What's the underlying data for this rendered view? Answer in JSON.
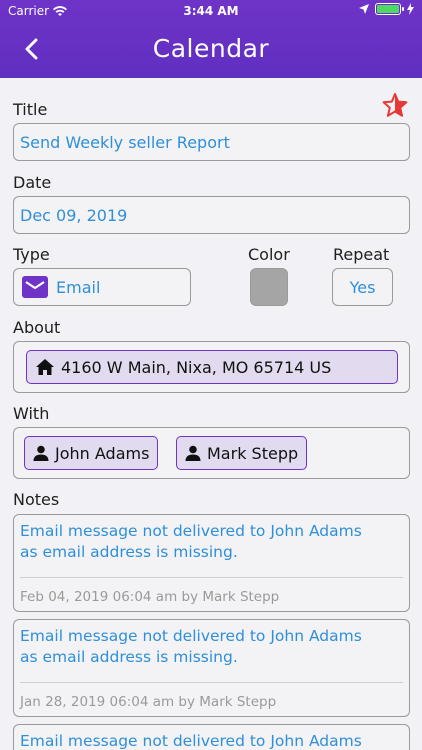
{
  "status_bar": {
    "carrier": "Carrier",
    "time": "3:44 AM",
    "battery_color": "#4cd964"
  },
  "header": {
    "title": "Calendar",
    "back_icon": "chevron-left-icon",
    "background": "#6f33c8"
  },
  "form": {
    "title_label": "Title",
    "title_value": "Send Weekly seller Report",
    "favorite_icon": "star-icon",
    "favorite_color": "#e53935",
    "date_label": "Date",
    "date_value": "Dec 09, 2019",
    "type_label": "Type",
    "type_value": "Email",
    "type_icon": "mail-icon",
    "color_label": "Color",
    "color_value": "#a5a5a5",
    "repeat_label": "Repeat",
    "repeat_value": "Yes",
    "about_label": "About",
    "about_value": "4160 W Main, Nixa, MO 65714 US",
    "about_icon": "home-icon",
    "with_label": "With",
    "with_people": [
      "John Adams",
      "Mark Stepp"
    ],
    "person_icon": "person-icon",
    "notes_label": "Notes"
  },
  "notes": [
    {
      "message_line1": "Email message not delivered to John Adams",
      "message_line2": "as email address is missing.",
      "meta": "Feb 04, 2019 06:04 am by Mark Stepp"
    },
    {
      "message_line1": "Email message not delivered to John Adams",
      "message_line2": "as email address is missing.",
      "meta": "Jan 28, 2019 06:04 am by Mark Stepp"
    },
    {
      "message_line1": "Email message not delivered to John Adams",
      "message_line2": "",
      "meta": ""
    }
  ]
}
